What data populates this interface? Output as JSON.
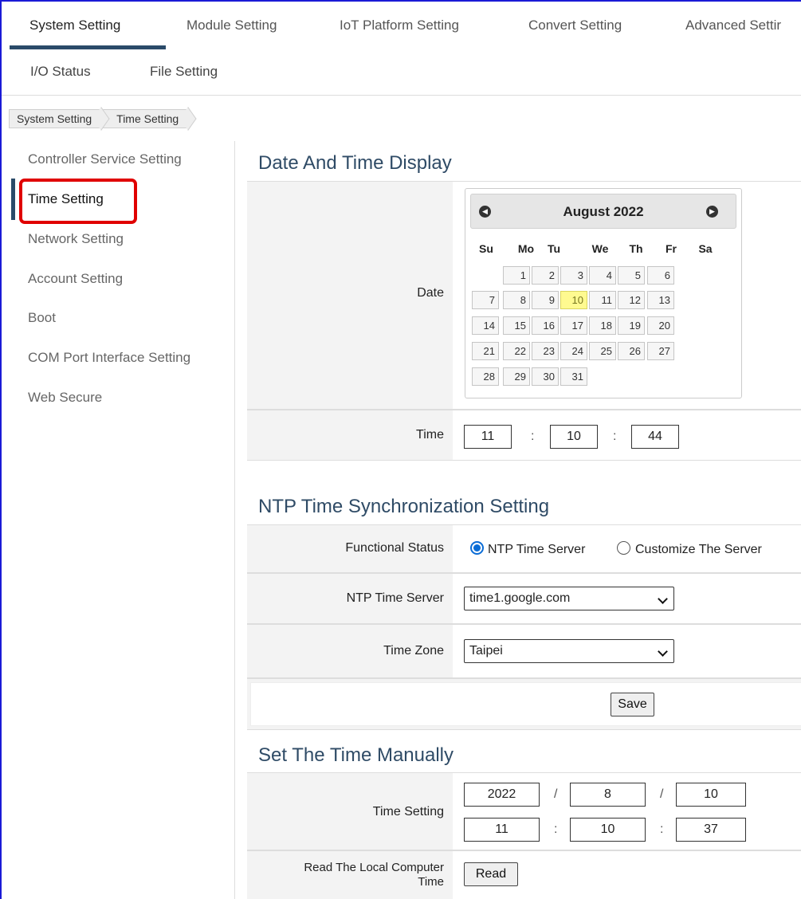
{
  "tabs_row1": [
    "System Setting",
    "Module Setting",
    "IoT Platform Setting",
    "Convert Setting",
    "Advanced Settir"
  ],
  "tabs_row2": [
    "I/O Status",
    "File Setting"
  ],
  "breadcrumb": [
    "System Setting",
    "Time Setting"
  ],
  "sidebar": {
    "items": [
      "Controller Service Setting",
      "Time Setting",
      "Network Setting",
      "Account Setting",
      "Boot",
      "COM Port Interface Setting",
      "Web Secure"
    ],
    "active": "Time Setting"
  },
  "date_time_display": {
    "title": "Date And Time Display",
    "date_label": "Date",
    "calendar": {
      "title": "August 2022",
      "weekdays": [
        "Su",
        "Mo",
        "Tu",
        "We",
        "Th",
        "Fr",
        "Sa"
      ],
      "first_weekday_index": 1,
      "days_in_month": 31,
      "selected_day": 10
    },
    "time_label": "Time",
    "time": {
      "hour": "11",
      "minute": "10",
      "second": "44"
    },
    "time_sep": ":"
  },
  "ntp": {
    "title": "NTP Time Synchronization Setting",
    "functional_status_label": "Functional Status",
    "option_ntp": "NTP Time Server",
    "option_custom": "Customize The Server",
    "selected_option": "NTP Time Server",
    "server_label": "NTP Time Server",
    "server_value": "time1.google.com",
    "timezone_label": "Time Zone",
    "timezone_value": "Taipei",
    "save_label": "Save"
  },
  "manual": {
    "title": "Set The Time Manually",
    "time_setting_label": "Time Setting",
    "year": "2022",
    "month": "8",
    "day": "10",
    "date_sep": "/",
    "hour": "11",
    "minute": "10",
    "second": "37",
    "time_sep": ":",
    "read_label_line1": "Read The Local Computer",
    "read_label_line2": "Time",
    "read_button": "Read"
  },
  "colors": {
    "accent": "#2a4b69",
    "highlight_box": "#e00000",
    "frame": "#1a1ad6",
    "today": "#fffa90"
  }
}
